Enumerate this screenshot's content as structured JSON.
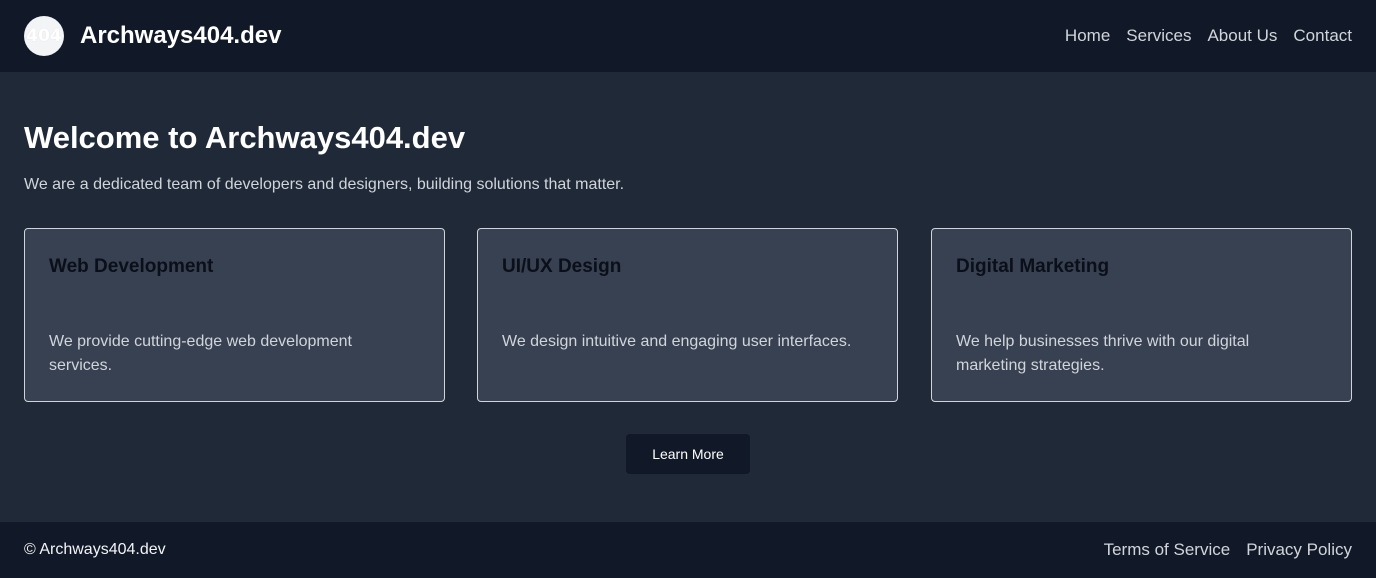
{
  "header": {
    "logo_text": "404",
    "logo_icon": "circle-logo-icon",
    "brand": "Archways404.dev",
    "nav": [
      "Home",
      "Services",
      "About Us",
      "Contact"
    ]
  },
  "hero": {
    "title": "Welcome to Archways404.dev",
    "subtitle": "We are a dedicated team of developers and designers, building solutions that matter."
  },
  "cards": [
    {
      "title": "Web Development",
      "description": "We provide cutting-edge web development services."
    },
    {
      "title": "UI/UX Design",
      "description": "We design intuitive and engaging user interfaces."
    },
    {
      "title": "Digital Marketing",
      "description": "We help businesses thrive with our digital marketing strategies."
    }
  ],
  "cta": {
    "label": "Learn More"
  },
  "footer": {
    "copyright": "© Archways404.dev",
    "links": [
      "Terms of Service",
      "Privacy Policy"
    ]
  },
  "colors": {
    "header_bg": "#111827",
    "page_bg": "#1f2937",
    "card_bg": "#374151",
    "card_border": "#d1d5db",
    "button_bg": "#111827"
  }
}
